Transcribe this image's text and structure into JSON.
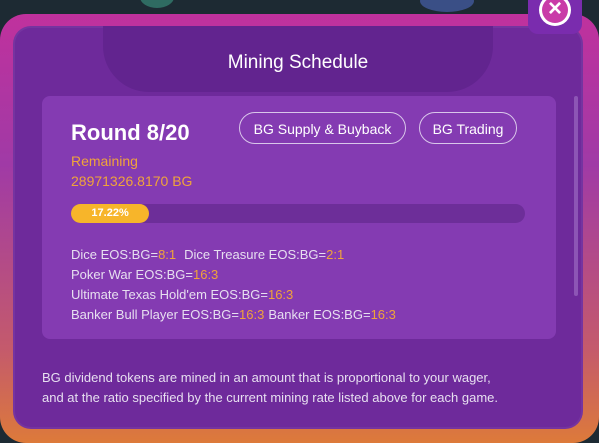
{
  "modal": {
    "title": "Mining Schedule",
    "close_icon": "close-icon"
  },
  "card": {
    "round": "Round 8/20",
    "buttons": {
      "supply": "BG Supply & Buyback",
      "trading": "BG Trading"
    },
    "remaining_label": "Remaining",
    "remaining_value": "28971326.8170 BG",
    "progress": {
      "percent": 17.22,
      "label": "17.22%"
    },
    "rates": [
      [
        {
          "name": "Dice EOS:BG=",
          "value": "8:1"
        },
        {
          "name": "Dice Treasure EOS:BG=",
          "value": "2:1"
        }
      ],
      [
        {
          "name": "Poker War EOS:BG=",
          "value": "16:3"
        }
      ],
      [
        {
          "name": "Ultimate Texas Hold'em EOS:BG=",
          "value": "16:3"
        }
      ],
      [
        {
          "name": "Banker Bull Player EOS:BG=",
          "value": "16:3"
        },
        {
          "name": "Banker EOS:BG=",
          "value": "16:3"
        }
      ]
    ]
  },
  "description": {
    "line1": "BG dividend tokens are mined in an amount that is proportional to your wager,",
    "line2": "and at the ratio specified by the current mining rate listed above for each game."
  },
  "colors": {
    "accent": "#f0a43a",
    "panel": "#6e2a9b",
    "card": "#843bb2",
    "progress": "#f7b52a"
  }
}
